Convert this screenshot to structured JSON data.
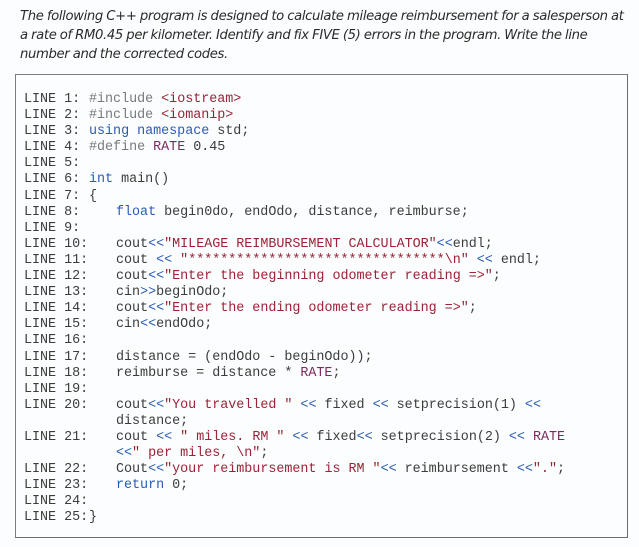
{
  "question": {
    "text": "The following C++ program is designed to calculate mileage reimbursement for a salesperson at a rate of RM0.45 per kilometer. Identify and fix FIVE (5) errors in the program. Write the line number and the corrected codes."
  },
  "code": {
    "lines": [
      {
        "label": "LINE 1:",
        "tokens": [
          {
            "t": "#include ",
            "c": "pp"
          },
          {
            "t": "<iostream>",
            "c": "str"
          }
        ]
      },
      {
        "label": "LINE 2:",
        "tokens": [
          {
            "t": "#include ",
            "c": "pp"
          },
          {
            "t": "<iomanip>",
            "c": "str"
          }
        ]
      },
      {
        "label": "LINE 3:",
        "tokens": [
          {
            "t": "using namespace",
            "c": "kw"
          },
          {
            "t": " std;",
            "c": "plain"
          }
        ]
      },
      {
        "label": "LINE 4:",
        "tokens": [
          {
            "t": "#define ",
            "c": "pp"
          },
          {
            "t": "RATE",
            "c": "mac"
          },
          {
            "t": " 0.45",
            "c": "plain"
          }
        ]
      },
      {
        "label": "LINE 5:",
        "tokens": []
      },
      {
        "label": "LINE 6:",
        "tokens": [
          {
            "t": "int",
            "c": "kw"
          },
          {
            "t": " main()",
            "c": "plain"
          }
        ]
      },
      {
        "label": "LINE 7:",
        "tokens": [
          {
            "t": "{",
            "c": "plain"
          }
        ]
      },
      {
        "label": "LINE 8:",
        "indent": true,
        "tokens": [
          {
            "t": "float",
            "c": "kw"
          },
          {
            "t": " begin0do, endOdo, distance, reimburse;",
            "c": "plain"
          }
        ]
      },
      {
        "label": "LINE 9:",
        "tokens": []
      },
      {
        "label": "LINE 10:",
        "indent": true,
        "tokens": [
          {
            "t": "cout",
            "c": "plain"
          },
          {
            "t": "<<",
            "c": "op"
          },
          {
            "t": "\"MILEAGE REIMBURSEMENT CALCULATOR\"",
            "c": "str"
          },
          {
            "t": "<<",
            "c": "op"
          },
          {
            "t": "endl;",
            "c": "plain"
          }
        ]
      },
      {
        "label": "LINE 11:",
        "indent": true,
        "tokens": [
          {
            "t": "cout ",
            "c": "plain"
          },
          {
            "t": "<<",
            "c": "op"
          },
          {
            "t": " ",
            "c": "plain"
          },
          {
            "t": "\"********************************\\n\"",
            "c": "str"
          },
          {
            "t": " ",
            "c": "plain"
          },
          {
            "t": "<<",
            "c": "op"
          },
          {
            "t": " endl;",
            "c": "plain"
          }
        ]
      },
      {
        "label": "LINE 12:",
        "indent": true,
        "tokens": [
          {
            "t": "cout",
            "c": "plain"
          },
          {
            "t": "<<",
            "c": "op"
          },
          {
            "t": "\"Enter the beginning odometer reading =>\"",
            "c": "str"
          },
          {
            "t": ";",
            "c": "plain"
          }
        ]
      },
      {
        "label": "LINE 13:",
        "indent": true,
        "tokens": [
          {
            "t": "cin",
            "c": "plain"
          },
          {
            "t": ">>",
            "c": "op"
          },
          {
            "t": "beginOdo;",
            "c": "plain"
          }
        ]
      },
      {
        "label": "LINE 14:",
        "indent": true,
        "tokens": [
          {
            "t": "cout",
            "c": "plain"
          },
          {
            "t": "<<",
            "c": "op"
          },
          {
            "t": "\"Enter the ending odometer reading =>\"",
            "c": "str"
          },
          {
            "t": ";",
            "c": "plain"
          }
        ]
      },
      {
        "label": "LINE 15:",
        "indent": true,
        "tokens": [
          {
            "t": "cin",
            "c": "plain"
          },
          {
            "t": "<<",
            "c": "op"
          },
          {
            "t": "endOdo;",
            "c": "plain"
          }
        ]
      },
      {
        "label": "LINE 16:",
        "tokens": []
      },
      {
        "label": "LINE 17:",
        "indent": true,
        "tokens": [
          {
            "t": "distance = (endOdo - beginOdo));",
            "c": "plain"
          }
        ]
      },
      {
        "label": "LINE 18:",
        "indent": true,
        "tokens": [
          {
            "t": "reimburse = distance * ",
            "c": "plain"
          },
          {
            "t": "RATE",
            "c": "mac"
          },
          {
            "t": ";",
            "c": "plain"
          }
        ]
      },
      {
        "label": "LINE 19:",
        "tokens": []
      },
      {
        "label": "LINE 20:",
        "indent": true,
        "tokens": [
          {
            "t": "cout",
            "c": "plain"
          },
          {
            "t": "<<",
            "c": "op"
          },
          {
            "t": "\"You travelled \"",
            "c": "str"
          },
          {
            "t": " ",
            "c": "plain"
          },
          {
            "t": "<<",
            "c": "op"
          },
          {
            "t": " fixed ",
            "c": "plain"
          },
          {
            "t": "<<",
            "c": "op"
          },
          {
            "t": " setprecision(1) ",
            "c": "plain"
          },
          {
            "t": "<<",
            "c": "op"
          }
        ],
        "cont": [
          {
            "t": "distance;",
            "c": "plain"
          }
        ]
      },
      {
        "label": "LINE 21:",
        "indent": true,
        "tokens": [
          {
            "t": "cout ",
            "c": "plain"
          },
          {
            "t": "<<",
            "c": "op"
          },
          {
            "t": " ",
            "c": "plain"
          },
          {
            "t": "\" miles. RM \"",
            "c": "str"
          },
          {
            "t": " ",
            "c": "plain"
          },
          {
            "t": "<<",
            "c": "op"
          },
          {
            "t": " fixed",
            "c": "plain"
          },
          {
            "t": "<<",
            "c": "op"
          },
          {
            "t": " setprecision(2) ",
            "c": "plain"
          },
          {
            "t": "<<",
            "c": "op"
          },
          {
            "t": " ",
            "c": "plain"
          },
          {
            "t": "RATE",
            "c": "mac"
          }
        ],
        "cont": [
          {
            "t": "<<",
            "c": "op"
          },
          {
            "t": "\" per miles, \\n\"",
            "c": "str"
          },
          {
            "t": ";",
            "c": "plain"
          }
        ]
      },
      {
        "label": "LINE 22:",
        "indent": true,
        "tokens": [
          {
            "t": "Cout",
            "c": "plain"
          },
          {
            "t": "<<",
            "c": "op"
          },
          {
            "t": "\"your reimbursement is RM \"",
            "c": "str"
          },
          {
            "t": "<<",
            "c": "op"
          },
          {
            "t": " reimbursement ",
            "c": "plain"
          },
          {
            "t": "<<",
            "c": "op"
          },
          {
            "t": "\".\"",
            "c": "str"
          },
          {
            "t": ";",
            "c": "plain"
          }
        ]
      },
      {
        "label": "LINE 23:",
        "indent": true,
        "tokens": [
          {
            "t": "return",
            "c": "kw"
          },
          {
            "t": " 0;",
            "c": "plain"
          }
        ]
      },
      {
        "label": "LINE 24:",
        "tokens": []
      },
      {
        "label": "LINE 25:",
        "tokens": [
          {
            "t": "}",
            "c": "plain"
          }
        ]
      }
    ]
  }
}
